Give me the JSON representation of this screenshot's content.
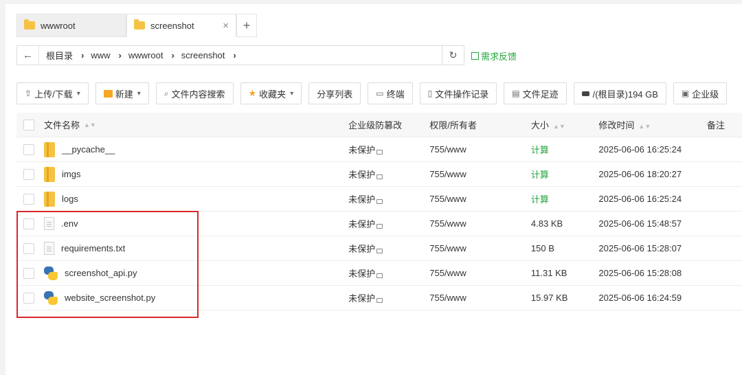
{
  "tabs": [
    {
      "label": "wwwroot",
      "active": false
    },
    {
      "label": "screenshot",
      "active": true
    }
  ],
  "tab_close": "×",
  "tab_add": "+",
  "breadcrumb": {
    "back": "←",
    "items": [
      "根目录",
      "www",
      "wwwroot",
      "screenshot"
    ],
    "separator": "›",
    "refresh": "↻"
  },
  "feedback": "需求反馈",
  "toolbar": {
    "upload": "上传/下载",
    "new": "新建",
    "search": "文件内容搜索",
    "favorites": "收藏夹",
    "share": "分享列表",
    "terminal": "终端",
    "oplog": "文件操作记录",
    "trace": "文件足迹",
    "disk": "/(根目录)194 GB",
    "enterprise": "企业级"
  },
  "table": {
    "headers": {
      "name": "文件名称",
      "protect": "企业级防篡改",
      "perm": "权限/所有者",
      "size": "大小",
      "time": "修改时间",
      "note": "备注"
    },
    "rows": [
      {
        "type": "folder",
        "name": "__pycache__",
        "protect": "未保护",
        "perm": "755/www",
        "size": "计算",
        "time": "2025-06-06 16:25:24"
      },
      {
        "type": "folder",
        "name": "imgs",
        "protect": "未保护",
        "perm": "755/www",
        "size": "计算",
        "time": "2025-06-06 18:20:27"
      },
      {
        "type": "folder",
        "name": "logs",
        "protect": "未保护",
        "perm": "755/www",
        "size": "计算",
        "time": "2025-06-06 16:25:24"
      },
      {
        "type": "text",
        "name": ".env",
        "protect": "未保护",
        "perm": "755/www",
        "size": "4.83 KB",
        "time": "2025-06-06 15:48:57"
      },
      {
        "type": "text",
        "name": "requirements.txt",
        "protect": "未保护",
        "perm": "755/www",
        "size": "150 B",
        "time": "2025-06-06 15:28:07"
      },
      {
        "type": "py",
        "name": "screenshot_api.py",
        "protect": "未保护",
        "perm": "755/www",
        "size": "11.31 KB",
        "time": "2025-06-06 15:28:08"
      },
      {
        "type": "py",
        "name": "website_screenshot.py",
        "protect": "未保护",
        "perm": "755/www",
        "size": "15.97 KB",
        "time": "2025-06-06 16:24:59"
      }
    ]
  },
  "colors": {
    "accent": "#20a53a",
    "highlight": "#d9262c",
    "folder": "#f5c243"
  }
}
